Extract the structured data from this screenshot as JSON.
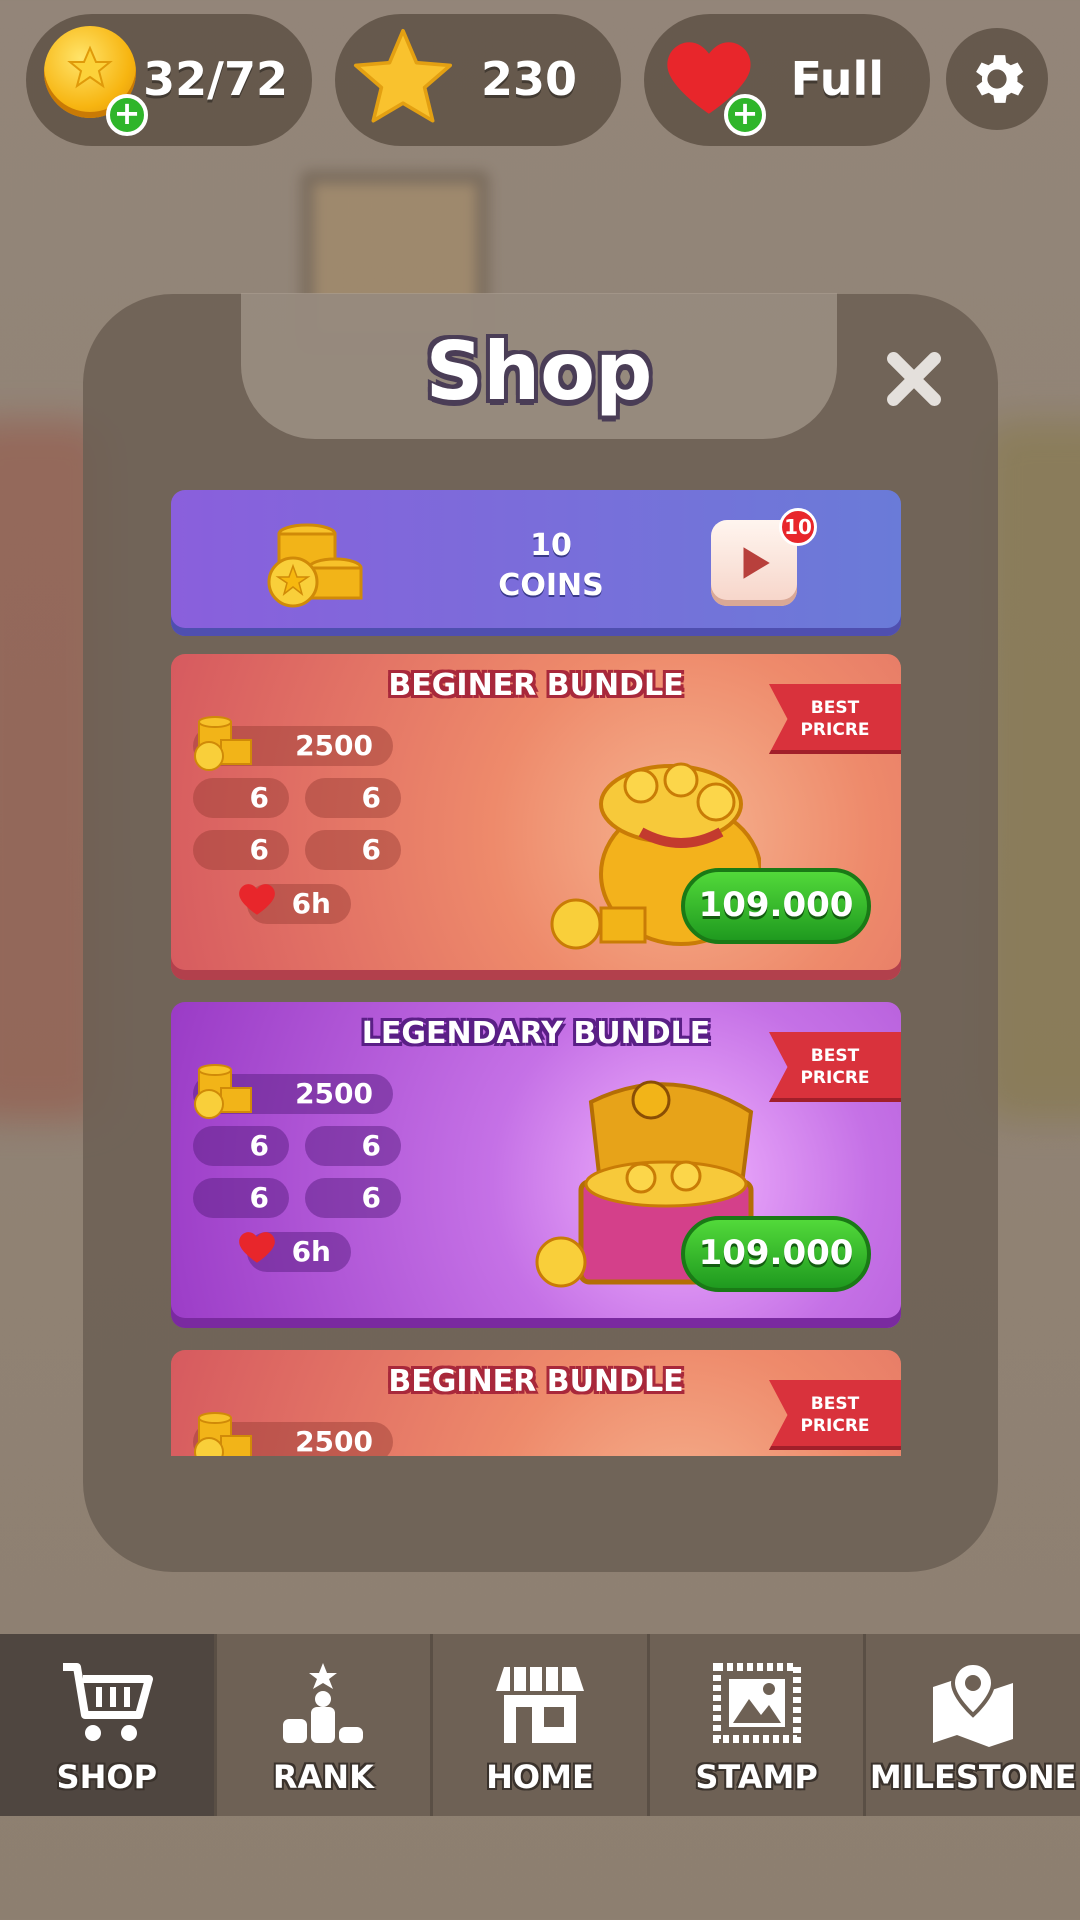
{
  "top_bar": {
    "coins": {
      "value": "32/72",
      "icon": "coin-icon",
      "add_icon": "plus-icon"
    },
    "stars": {
      "value": "230",
      "icon": "star-icon"
    },
    "lives": {
      "value": "Full",
      "icon": "heart-icon",
      "add_icon": "plus-icon"
    },
    "settings": {
      "icon": "gear-icon"
    }
  },
  "shop": {
    "title": "Shop",
    "close_icon": "close-icon",
    "video_offer": {
      "amount": "10",
      "unit": "COINS",
      "badge": "10",
      "icon": "play-video-icon"
    },
    "bundles": [
      {
        "title": "BEGINER BUNDLE",
        "theme": "orange",
        "coins": "2500",
        "items": [
          "6",
          "6",
          "6",
          "6"
        ],
        "hearts": "6h",
        "ribbon_line1": "BEST",
        "ribbon_line2": "PRICRE",
        "price": "109.000",
        "art_icon": "coin-bag-icon"
      },
      {
        "title": "LEGENDARY BUNDLE",
        "theme": "purple",
        "coins": "2500",
        "items": [
          "6",
          "6",
          "6",
          "6"
        ],
        "hearts": "6h",
        "ribbon_line1": "BEST",
        "ribbon_line2": "PRICRE",
        "price": "109.000",
        "art_icon": "treasure-chest-icon"
      },
      {
        "title": "BEGINER BUNDLE",
        "theme": "orange",
        "coins": "2500",
        "ribbon_line1": "BEST",
        "ribbon_line2": "PRICRE",
        "art_icon": "coin-bag-icon"
      }
    ]
  },
  "nav": {
    "items": [
      {
        "label": "SHOP",
        "icon": "cart-icon",
        "active": true
      },
      {
        "label": "RANK",
        "icon": "podium-icon",
        "active": false
      },
      {
        "label": "HOME",
        "icon": "store-icon",
        "active": false
      },
      {
        "label": "STAMP",
        "icon": "stamp-icon",
        "active": false
      },
      {
        "label": "MILESTONE",
        "icon": "map-pin-icon",
        "active": false
      }
    ]
  },
  "colors": {
    "price_green": "#2fb52a",
    "ribbon_red": "#d9323c",
    "video_card": "#7a6ddc",
    "nav_bg": "#6e6155"
  }
}
